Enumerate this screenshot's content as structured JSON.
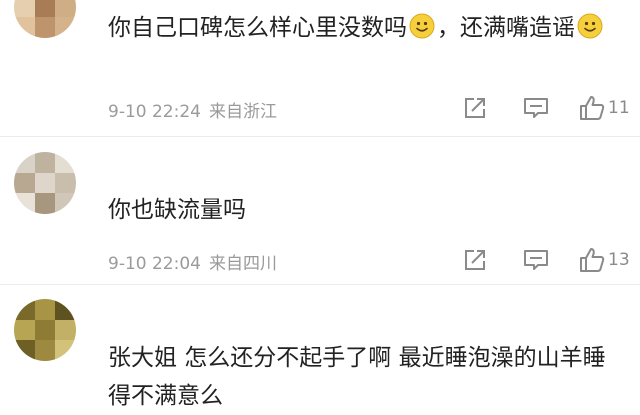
{
  "comments": [
    {
      "username": "",
      "text_parts": [
        "你自己口碑怎么样心里没数吗",
        "，还满嘴造谣"
      ],
      "date": "9-10 22:24",
      "location": "来自浙江",
      "likes": "11",
      "avatar_colors": [
        "#c9a77d",
        "#d9bb95",
        "#b89068",
        "#e6cfae",
        "#a87c55",
        "#cfad85",
        "#e0c29c",
        "#bd946b",
        "#d4b38c"
      ]
    },
    {
      "username": "",
      "text": "你也缺流量吗",
      "date": "9-10 22:04",
      "location": "来自四川",
      "likes": "13",
      "avatar_colors": [
        "#d8d2c7",
        "#bfb3a0",
        "#e4ddd2",
        "#b8a892",
        "#ded6ca",
        "#c9bdab",
        "#e8e2d9",
        "#a8977f",
        "#d1c7b8"
      ]
    },
    {
      "username": "",
      "text": "张大姐 怎么还分不起手了啊 最近睡泡澡的山羊睡得不满意么",
      "avatar_colors": [
        "#7a6a2a",
        "#a89445",
        "#5e5220",
        "#b8a553",
        "#8e7c35",
        "#c2b066",
        "#6e5f25",
        "#9d8a40",
        "#d2c27a"
      ]
    }
  ],
  "icons": {
    "share": "share-icon",
    "comment": "comment-icon",
    "like": "thumbs-up-icon",
    "smiley": "smiley-emoji-icon"
  },
  "colors": {
    "meta_text": "#9a9a9a",
    "emoji_face": "#f6cf3c"
  }
}
